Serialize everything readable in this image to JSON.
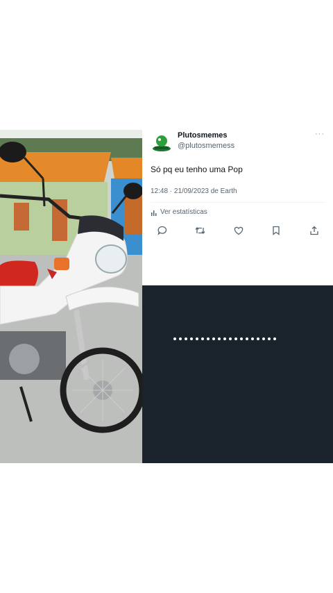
{
  "tweet": {
    "display_name": "Plutosmemes",
    "handle": "@plutosmemess",
    "more_icon": "more-horizontal-icon",
    "text": "Só pq eu tenho uma Pop",
    "timestamp": "12:48 · 21/09/2023 de Earth",
    "stats_label": "Ver estatísticas",
    "actions": [
      "reply-icon",
      "retweet-icon",
      "like-icon",
      "bookmark-icon",
      "share-icon"
    ]
  },
  "colors": {
    "dark_panel": "#1b232c",
    "avatar_green": "#2e9e3a",
    "icon_gray": "#536471"
  }
}
